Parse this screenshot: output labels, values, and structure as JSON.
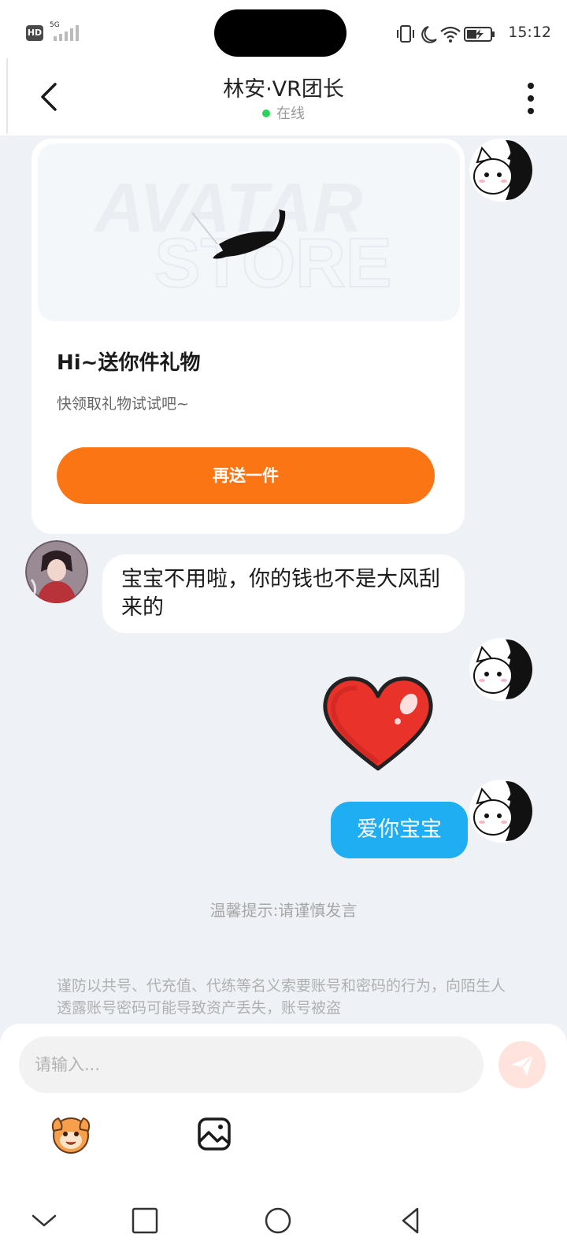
{
  "status_bar": {
    "hd": "HD",
    "network": "5G",
    "time": "15:12"
  },
  "header": {
    "title": "林安·VR团长",
    "status": "在线"
  },
  "gift_card": {
    "watermark_line1": "AVATAR",
    "watermark_line2": "STORE",
    "title": "Hi~送你件礼物",
    "subtitle": "快领取礼物试试吧~",
    "button_label": "再送一件"
  },
  "messages": {
    "received": "宝宝不用啦，你的钱也不是大风刮来的",
    "sent": "爱你宝宝"
  },
  "tip": "温馨提示:请谨慎发言",
  "warning": "谨防以共号、代充值、代练等名义索要账号和密码的行为，向陌生人透露账号密码可能导致资产丢失，账号被盗",
  "input": {
    "placeholder": "请输入..."
  },
  "colors": {
    "accent_orange": "#fb7514",
    "sent_bubble": "#20aef2",
    "online_dot": "#2bd35b",
    "background": "#eef2f7"
  }
}
